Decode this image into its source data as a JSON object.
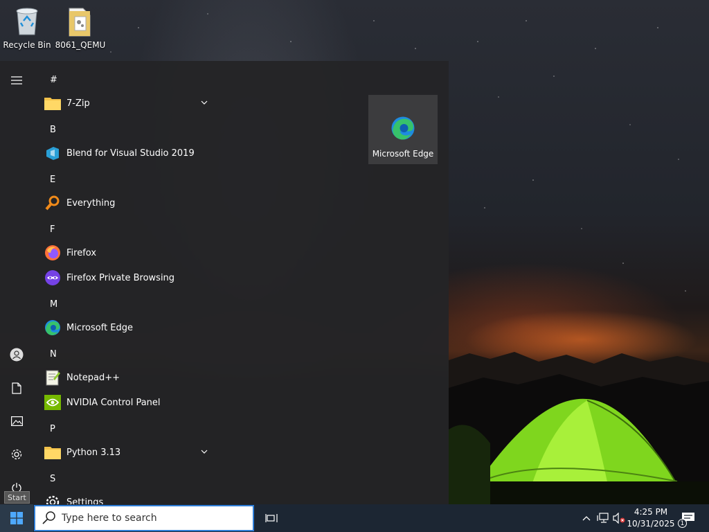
{
  "desktop": {
    "icons": [
      {
        "label": "Recycle Bin",
        "icon": "recycle-bin-icon"
      },
      {
        "label": "8061_QEMU",
        "icon": "folder-icon"
      }
    ]
  },
  "start_menu": {
    "rail": {
      "menu": "hamburger-icon",
      "user": "user-icon",
      "documents": "document-icon",
      "pictures": "pictures-icon",
      "settings": "gear-icon",
      "power": "power-icon"
    },
    "tooltip": "Start",
    "groups": [
      {
        "letter": "#",
        "apps": [
          {
            "label": "7-Zip",
            "icon": "folder-icon",
            "expandable": true
          }
        ]
      },
      {
        "letter": "B",
        "apps": [
          {
            "label": "Blend for Visual Studio 2019",
            "icon": "blend-icon",
            "expandable": false
          }
        ]
      },
      {
        "letter": "E",
        "apps": [
          {
            "label": "Everything",
            "icon": "magnifier-icon",
            "expandable": false
          }
        ]
      },
      {
        "letter": "F",
        "apps": [
          {
            "label": "Firefox",
            "icon": "firefox-icon",
            "expandable": false
          },
          {
            "label": "Firefox Private Browsing",
            "icon": "firefox-private-icon",
            "expandable": false
          }
        ]
      },
      {
        "letter": "M",
        "apps": [
          {
            "label": "Microsoft Edge",
            "icon": "edge-icon",
            "expandable": false
          }
        ]
      },
      {
        "letter": "N",
        "apps": [
          {
            "label": "Notepad++",
            "icon": "notepadpp-icon",
            "expandable": false
          },
          {
            "label": "NVIDIA Control Panel",
            "icon": "nvidia-icon",
            "expandable": false
          }
        ]
      },
      {
        "letter": "P",
        "apps": [
          {
            "label": "Python 3.13",
            "icon": "folder-icon",
            "expandable": true
          }
        ]
      },
      {
        "letter": "S",
        "apps": [
          {
            "label": "Settings",
            "icon": "gear-icon",
            "expandable": false
          }
        ]
      }
    ],
    "tiles": [
      {
        "label": "Microsoft Edge",
        "icon": "edge-icon"
      }
    ]
  },
  "taskbar": {
    "search": {
      "placeholder": "Type here to search",
      "value": ""
    },
    "clock": {
      "time": "4:25 PM",
      "date": "10/31/2025"
    },
    "notifications": {
      "count": "1"
    },
    "colors": {
      "accent": "#2f7ed8",
      "taskbar_bg": "#1c2633"
    }
  }
}
